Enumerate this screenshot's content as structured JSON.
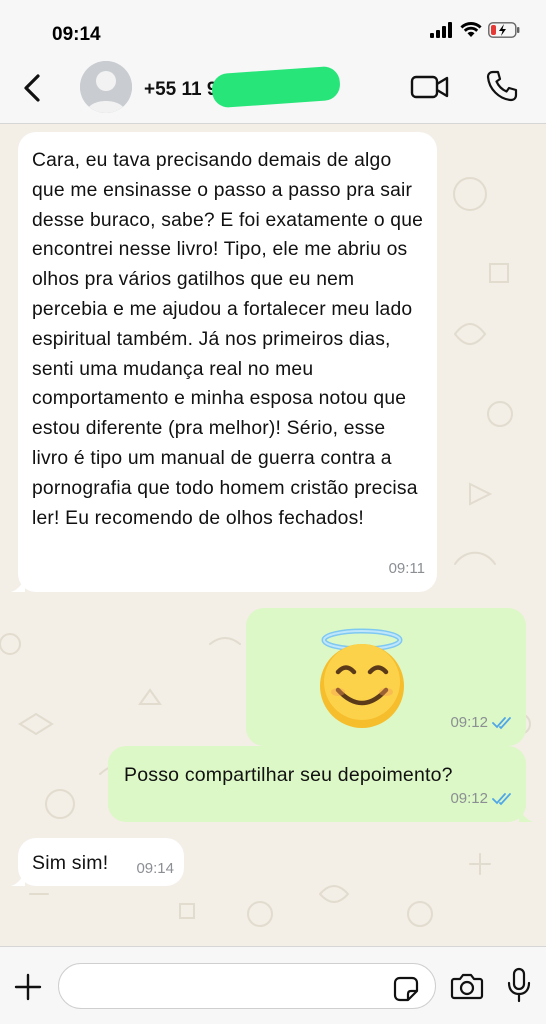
{
  "status_bar": {
    "time": "09:14",
    "icons": [
      "signal-icon",
      "wifi-icon",
      "battery-low-charging-icon"
    ]
  },
  "header": {
    "back_icon": "chevron-left-icon",
    "avatar_icon": "default-avatar-icon",
    "contact_name": "+55 11 9",
    "video_icon": "video-camera-icon",
    "call_icon": "phone-icon"
  },
  "messages": [
    {
      "direction": "incoming",
      "text": "Cara, eu tava precisando demais de algo que me ensinasse o passo a passo pra sair desse buraco, sabe? E foi exatamente o que encontrei nesse livro! Tipo, ele me abriu os olhos pra vários gatilhos que eu nem percebia e me ajudou a fortalecer meu lado espiritual também. Já nos primeiros dias, senti uma mudança real no meu comportamento e minha esposa notou que estou diferente (pra melhor)! Sério, esse livro é tipo um manual de guerra contra a pornografia que todo homem cristão precisa ler! Eu recomendo de olhos fechados!",
      "time": "09:11"
    },
    {
      "direction": "outgoing",
      "emoji": "😇",
      "time": "09:12",
      "status": "read"
    },
    {
      "direction": "outgoing",
      "text": "Posso compartilhar seu depoimento?",
      "time": "09:12",
      "status": "read"
    },
    {
      "direction": "incoming",
      "text": "Sim sim!",
      "time": "09:14"
    }
  ],
  "input_bar": {
    "plus_icon": "plus-icon",
    "placeholder": "",
    "sticker_icon": "sticker-icon",
    "camera_icon": "camera-icon",
    "mic_icon": "microphone-icon"
  },
  "colors": {
    "incoming_bubble": "#ffffff",
    "outgoing_bubble": "#dcf8c6",
    "chat_background": "#f3eee6",
    "read_ticks": "#4fa6e8",
    "redaction": "#28e57a"
  }
}
